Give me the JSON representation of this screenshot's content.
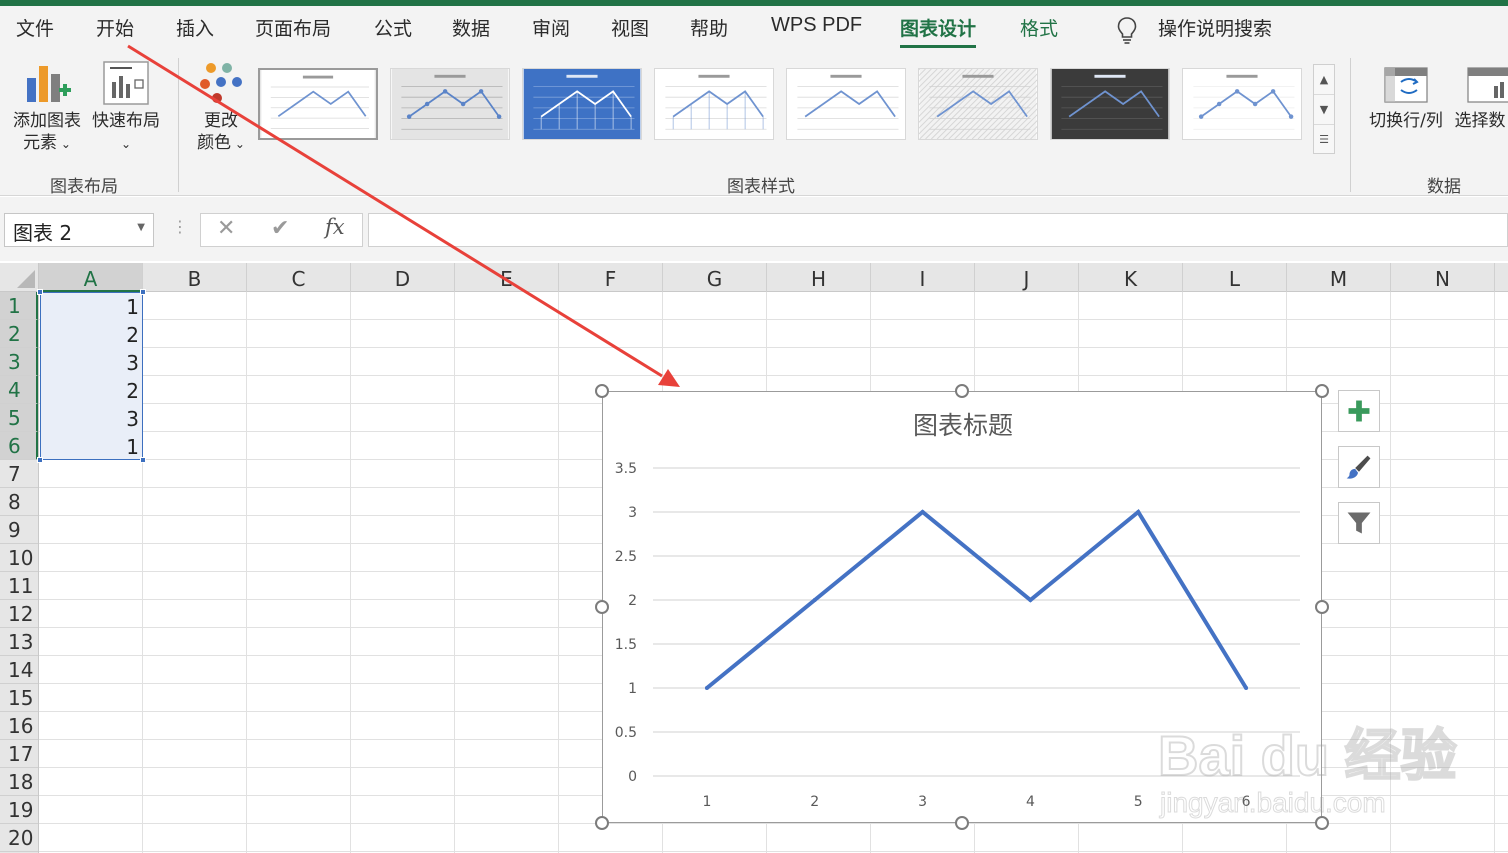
{
  "menu": {
    "tabs": [
      {
        "label": "文件"
      },
      {
        "label": "开始"
      },
      {
        "label": "插入"
      },
      {
        "label": "页面布局"
      },
      {
        "label": "公式"
      },
      {
        "label": "数据"
      },
      {
        "label": "审阅"
      },
      {
        "label": "视图"
      },
      {
        "label": "帮助"
      },
      {
        "label": "WPS PDF"
      },
      {
        "label": "图表设计",
        "active": true
      },
      {
        "label": "格式"
      }
    ],
    "search_label": "操作说明搜索",
    "search_icon": "lightbulb-icon"
  },
  "ribbon": {
    "add_element_line1": "添加图表",
    "add_element_line2": "元素",
    "quick_layout": "快速布局",
    "change_color_line1": "更改",
    "change_color_line2": "颜色",
    "switch_row_col": "切换行/列",
    "select_data": "选择数",
    "groups": {
      "layout": "图表布局",
      "styles": "图表样式",
      "data": "数据"
    },
    "style_count": 8,
    "selected_style": 1
  },
  "formula_bar": {
    "name_box": "图表 2",
    "formula": ""
  },
  "sheet": {
    "columns": [
      "A",
      "B",
      "C",
      "D",
      "E",
      "F",
      "G",
      "H",
      "I",
      "J",
      "K",
      "L",
      "M",
      "N"
    ],
    "rows": [
      "1",
      "2",
      "3",
      "4",
      "5",
      "6",
      "7",
      "8",
      "9",
      "10",
      "11",
      "12",
      "13",
      "14",
      "15",
      "16",
      "17",
      "18",
      "19",
      "20"
    ],
    "column_a_values": [
      "1",
      "2",
      "3",
      "2",
      "3",
      "1"
    ],
    "selected_column": "A",
    "selected_rows": [
      "1",
      "2",
      "3",
      "4",
      "5",
      "6"
    ]
  },
  "chart_data": {
    "type": "line",
    "title": "图表标题",
    "categories": [
      "1",
      "2",
      "3",
      "4",
      "5",
      "6"
    ],
    "x": [
      1,
      2,
      3,
      4,
      5,
      6
    ],
    "series": [
      {
        "values": [
          1,
          2,
          3,
          2,
          3,
          1
        ],
        "color": "#4472c4"
      }
    ],
    "ylim": [
      0,
      3.5
    ],
    "yticks": [
      "0",
      "0.5",
      "1",
      "1.5",
      "2",
      "2.5",
      "3",
      "3.5"
    ],
    "grid": true,
    "legend": "none"
  },
  "chart_tools": [
    "plus-icon",
    "brush-icon",
    "filter-icon"
  ],
  "colors": {
    "accent": "#217346",
    "series": "#4472c4",
    "arrow": "#e8413a",
    "selection": "#3c6fbf"
  },
  "watermark": {
    "brand": "Bai du 经验",
    "url": "jingyan.baidu.com"
  }
}
